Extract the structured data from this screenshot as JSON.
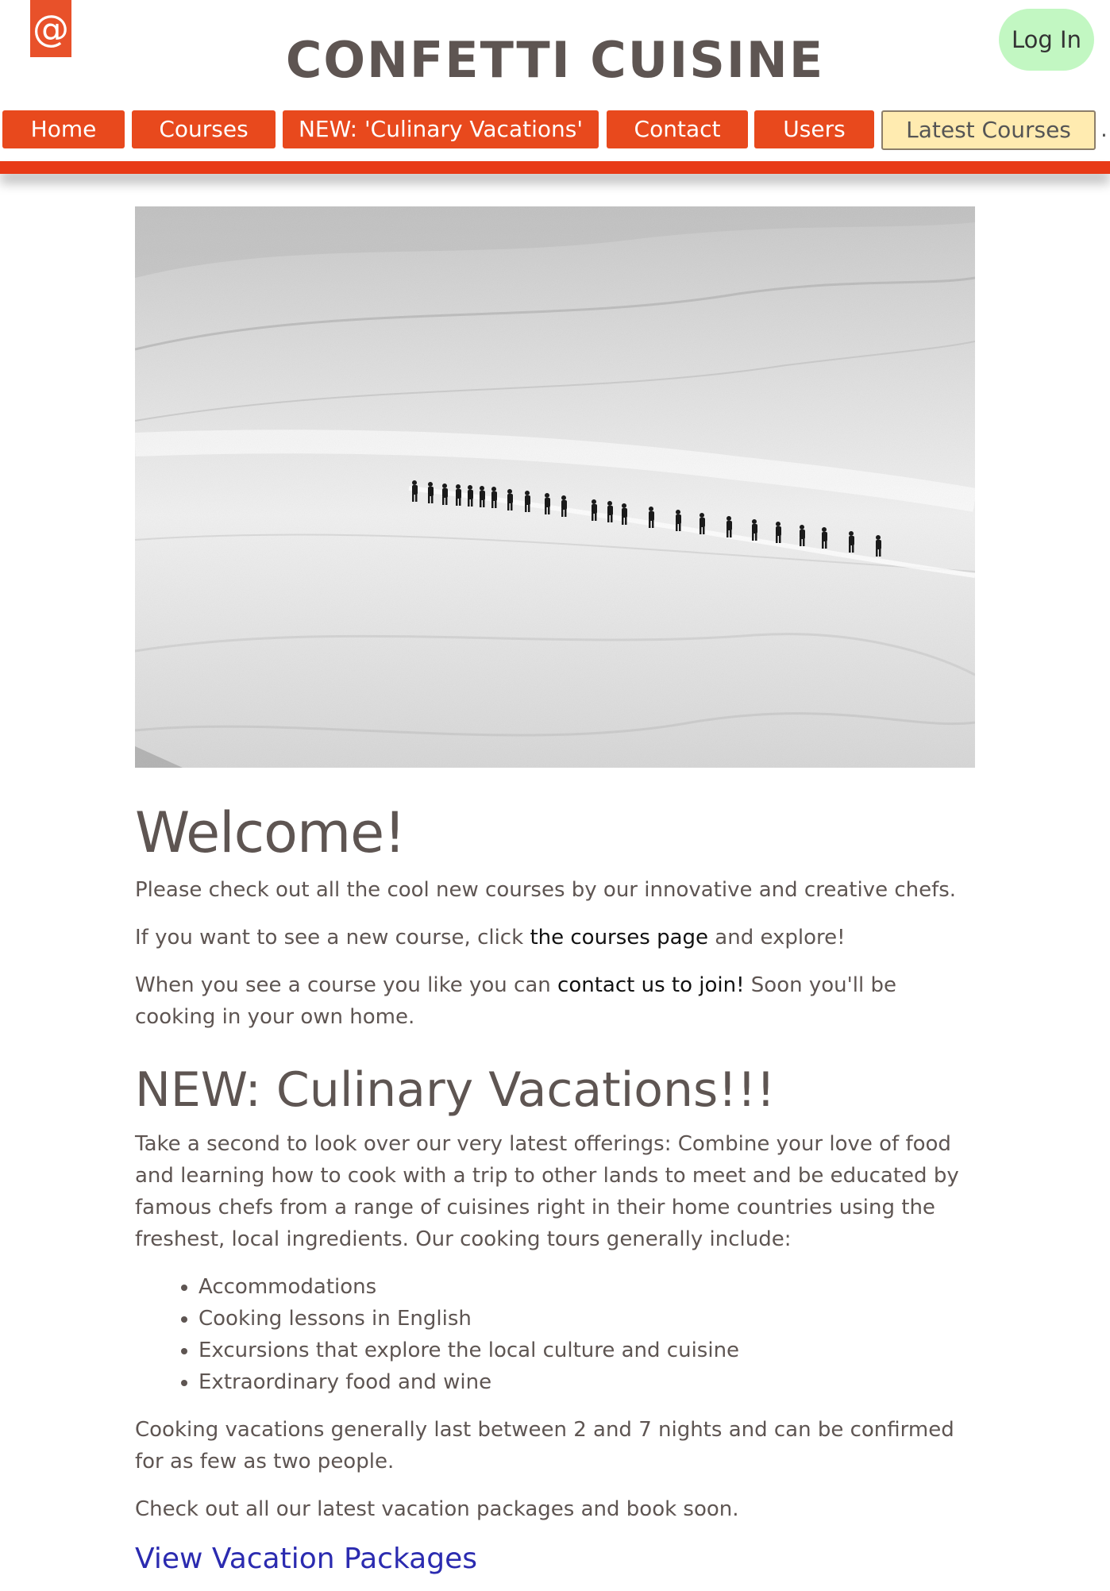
{
  "header": {
    "logo_text": "@",
    "site_title": "CONFETTI CUISINE",
    "login_label": "Log In",
    "login_color": "#c2f7c2"
  },
  "nav": {
    "items": [
      {
        "label": "Home"
      },
      {
        "label": "Courses"
      },
      {
        "label": "NEW: 'Culinary Vacations'"
      },
      {
        "label": "Contact"
      },
      {
        "label": "Users"
      },
      {
        "label": "Latest Courses"
      }
    ],
    "trailing": ".",
    "accent": "#e8491d",
    "highlight": "#ffebb0"
  },
  "hero": {
    "subject": "snowfield with a line of hikers"
  },
  "welcome": {
    "title": "Welcome!",
    "p1": "Please check out all the cool new courses by our innovative and creative chefs.",
    "p2_before": "If you want to see a new course, click ",
    "p2_link": "the courses page",
    "p2_after": " and explore!",
    "p3_before": "When you see a course you like you can ",
    "p3_link": "contact us to join!",
    "p3_after": " Soon you'll be cooking in your own home."
  },
  "vacations": {
    "title": "NEW: Culinary Vacations!!!",
    "intro": "Take a second to look over our very latest offerings: Combine your love of food and learning how to cook with a trip to other lands to meet and be educated by famous chefs from a range of cuisines right in their home countries using the freshest, local ingredients. Our cooking tours generally include:",
    "list": [
      "Accommodations",
      "Cooking lessons in English",
      "Excursions that explore the local culture and cuisine",
      "Extraordinary food and wine"
    ],
    "duration": "Cooking vacations generally last between 2 and 7 nights and can be confirmed for as few as two people.",
    "cta_text": "Check out all our latest vacation packages and book soon.",
    "packages_link": "View Vacation Packages"
  }
}
